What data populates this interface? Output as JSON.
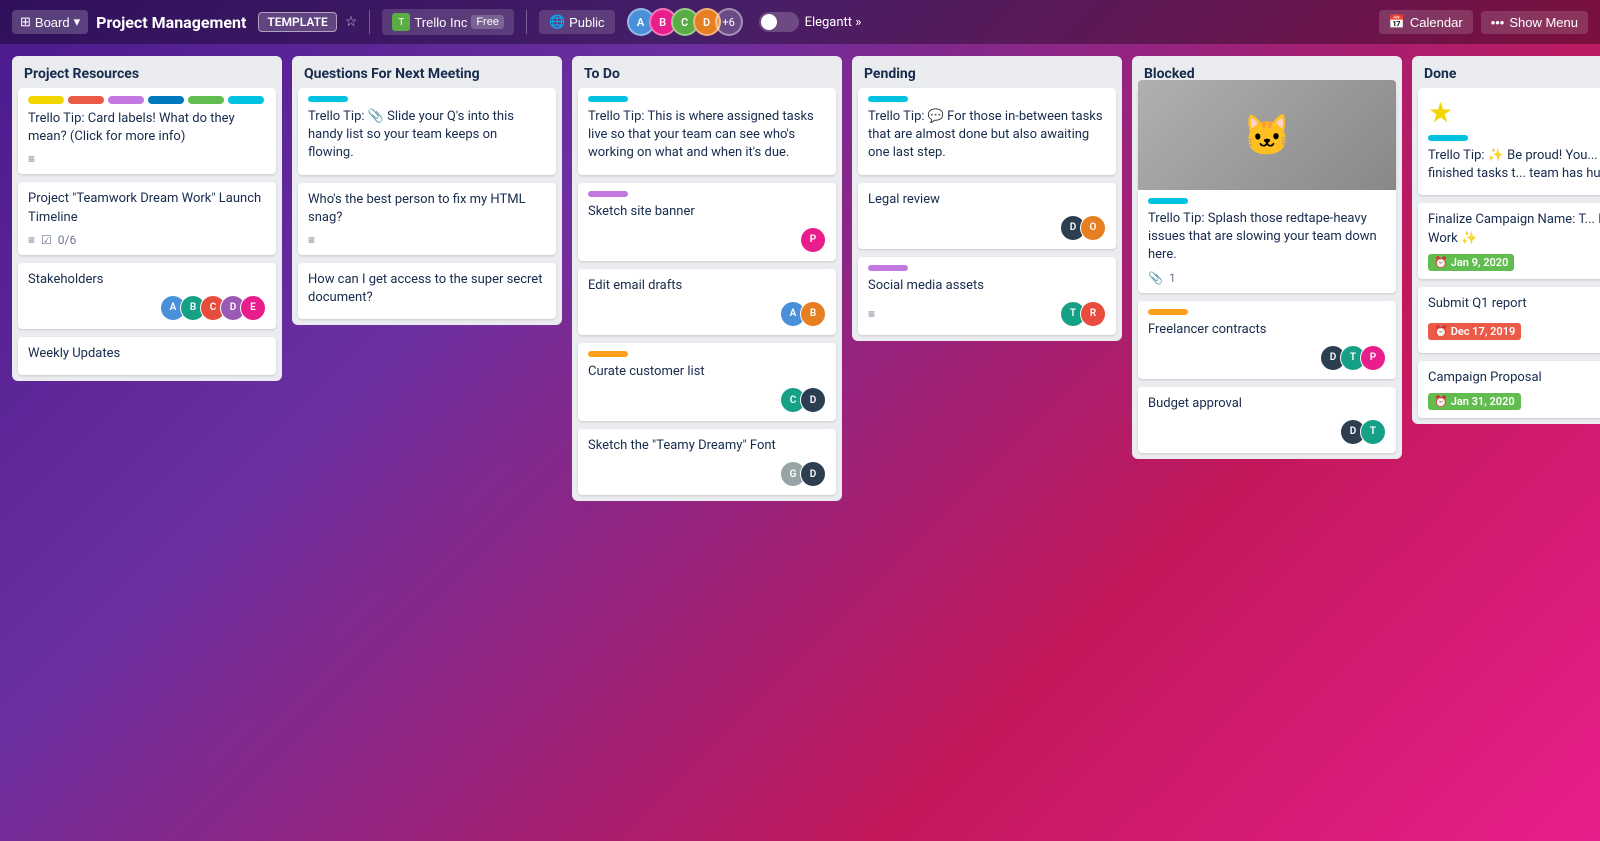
{
  "header": {
    "board_label": "Board",
    "title": "Project Management",
    "template_badge": "TEMPLATE",
    "workspace_name": "Trello Inc",
    "workspace_plan": "Free",
    "visibility": "Public",
    "members_count": "+6",
    "toggle_label": "off",
    "toggle_brand": "Elegantt »",
    "calendar_label": "Calendar",
    "show_menu_label": "Show Menu"
  },
  "columns": [
    {
      "id": "project-resources",
      "title": "Project Resources",
      "cards": [
        {
          "id": "pr-1",
          "label_colors": [
            "yellow",
            "red",
            "purple",
            "blue",
            "green",
            "cyan"
          ],
          "title": "Trello Tip: Card labels! What do they mean? (Click for more info)",
          "has_desc": true,
          "avatars": []
        },
        {
          "id": "pr-2",
          "title": "Project \"Teamwork Dream Work\" Launch Timeline",
          "has_desc": false,
          "checklist": "0/6",
          "avatars": []
        },
        {
          "id": "pr-3",
          "title": "Stakeholders",
          "avatars": [
            "blue",
            "teal",
            "red",
            "purple",
            "pink"
          ]
        },
        {
          "id": "pr-4",
          "title": "Weekly Updates",
          "avatars": []
        }
      ]
    },
    {
      "id": "questions-next-meeting",
      "title": "Questions For Next Meeting",
      "label_color": "cyan",
      "cards": [
        {
          "id": "qm-1",
          "label_color": "cyan",
          "title": "Trello Tip: 📎 Slide your Q's into this handy list so your team keeps on flowing.",
          "avatars": []
        },
        {
          "id": "qm-2",
          "title": "Who's the best person to fix my HTML snag?",
          "has_desc": true,
          "avatars": []
        },
        {
          "id": "qm-3",
          "title": "How can I get access to the super secret document?",
          "avatars": []
        }
      ]
    },
    {
      "id": "to-do",
      "title": "To Do",
      "label_color": "cyan",
      "cards": [
        {
          "id": "td-1",
          "label_color": "cyan",
          "title": "Trello Tip: This is where assigned tasks live so that your team can see who's working on what and when it's due.",
          "avatars": []
        },
        {
          "id": "td-2",
          "label_color": "purple",
          "title": "Sketch site banner",
          "avatars": [
            "pink"
          ]
        },
        {
          "id": "td-3",
          "title": "Edit email drafts",
          "avatars": [
            "blue",
            "orange"
          ]
        },
        {
          "id": "td-4",
          "label_color": "orange",
          "title": "Curate customer list",
          "avatars": [
            "teal",
            "dark"
          ]
        },
        {
          "id": "td-5",
          "title": "Sketch the \"Teamy Dreamy\" Font",
          "avatars": [
            "gray",
            "dark"
          ]
        }
      ]
    },
    {
      "id": "pending",
      "title": "Pending",
      "label_color": "cyan",
      "cards": [
        {
          "id": "pe-1",
          "label_color": "cyan",
          "title": "Trello Tip: 💬 For those in-between tasks that are almost done but also awaiting one last step.",
          "avatars": []
        },
        {
          "id": "pe-2",
          "title": "Legal review",
          "avatars": [
            "dark",
            "orange"
          ]
        },
        {
          "id": "pe-3",
          "label_color": "purple",
          "title": "Social media assets",
          "has_desc": true,
          "avatars": [
            "teal",
            "red"
          ]
        }
      ]
    },
    {
      "id": "blocked",
      "title": "Blocked",
      "label_color": "cyan",
      "cards": [
        {
          "id": "bl-1",
          "has_image": true,
          "label_color": "cyan",
          "title": "Trello Tip: Splash those redtape-heavy issues that are slowing your team down here.",
          "attachment_count": "1",
          "avatars": []
        },
        {
          "id": "bl-2",
          "label_color": "orange",
          "title": "Freelancer contracts",
          "avatars": [
            "dark",
            "teal",
            "pink"
          ]
        },
        {
          "id": "bl-3",
          "title": "Budget approval",
          "avatars": [
            "dark",
            "teal"
          ]
        }
      ]
    },
    {
      "id": "done",
      "title": "Done",
      "label_color": "cyan",
      "cards": [
        {
          "id": "dn-1",
          "has_star": true,
          "label_color": "cyan",
          "title": "Trello Tip: ✨ Be proud! You... For all your finished tasks t... team has hustled on.",
          "avatars": []
        },
        {
          "id": "dn-2",
          "title": "Finalize Campaign Name: T... Dream Work ✨",
          "due": "Jan 9, 2020",
          "due_status": "done",
          "avatars": []
        },
        {
          "id": "dn-3",
          "title": "Submit Q1 report",
          "due": "Dec 17, 2019",
          "due_status": "overdue",
          "avatars": [
            "pink"
          ]
        },
        {
          "id": "dn-4",
          "title": "Campaign Proposal",
          "due": "Jan 31, 2020",
          "due_status": "done",
          "avatars": []
        }
      ]
    }
  ]
}
